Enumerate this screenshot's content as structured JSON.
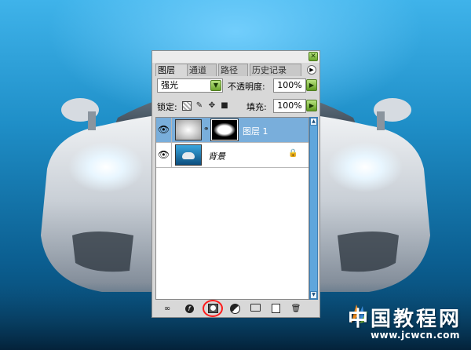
{
  "panel": {
    "tabs": [
      {
        "label": "图层",
        "active": true
      },
      {
        "label": "通道",
        "active": false
      },
      {
        "label": "路径",
        "active": false
      },
      {
        "label": "历史记录",
        "active": false
      }
    ],
    "menu_icon": "triangle-right-icon",
    "close_icon": "close-icon",
    "blend_mode": "强光",
    "opacity_label": "不透明度:",
    "opacity_value": "100%",
    "lock_label": "锁定:",
    "fill_label": "填充:",
    "fill_value": "100%",
    "layers": [
      {
        "name": "图层 1",
        "selected": true,
        "visible": true,
        "has_mask": true
      },
      {
        "name": "背景",
        "selected": false,
        "visible": true,
        "locked": true
      }
    ],
    "bottom_icons": [
      "link-icon",
      "layer-style-icon",
      "add-mask-icon",
      "adjustment-layer-icon",
      "group-folder-icon",
      "new-layer-icon",
      "trash-icon"
    ]
  },
  "watermark": {
    "chinese": "中国教程网",
    "url": "www.jcwcn.com"
  },
  "colors": {
    "selection": "#79aedb",
    "accent_green": "#6ca52c",
    "highlight_red": "#ff1a1a"
  }
}
